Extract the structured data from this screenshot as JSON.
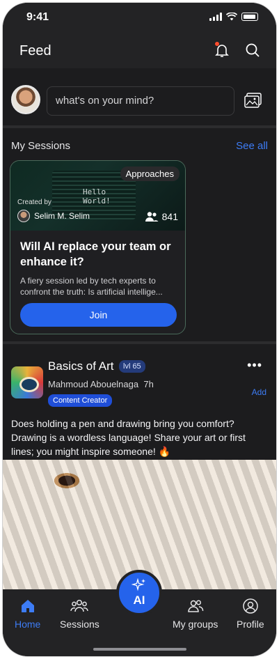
{
  "status_bar": {
    "time": "9:41"
  },
  "header": {
    "title": "Feed"
  },
  "composer": {
    "placeholder": "what's on your mind?"
  },
  "sessions": {
    "label": "My Sessions",
    "see_all": "See all",
    "card": {
      "tag": "Approaches",
      "cover_text_line1": "Hello",
      "cover_text_line2": "World!",
      "created_by_label": "Created by",
      "creator": "Selim M. Selim",
      "members": "841",
      "title": "Will AI replace your team or enhance it?",
      "description": "A fiery session led by tech experts to confront the truth: Is artificial intellige...",
      "join_label": "Join"
    }
  },
  "post": {
    "group": "Basics of Art",
    "level": "lvl 65",
    "author": "Mahmoud Abouelnaga",
    "time": "7h",
    "role": "Content Creator",
    "add_label": "Add",
    "more": "•••",
    "text": "Does holding a pen and drawing bring you comfort? Drawing is a wordless language! Share your art or first lines; you might inspire someone! 🔥"
  },
  "nav": {
    "home": "Home",
    "sessions": "Sessions",
    "ai": "AI",
    "groups": "My groups",
    "profile": "Profile"
  },
  "colors": {
    "accent": "#2563eb",
    "link": "#3d7cf5",
    "background": "#1c1c1e",
    "notification_dot": "#ff4d2e"
  },
  "icons": [
    "signal-icon",
    "wifi-icon",
    "battery-icon",
    "bell-icon",
    "search-icon",
    "image-icon",
    "users-icon",
    "home-icon",
    "sessions-icon",
    "sparkles-icon",
    "groups-icon",
    "profile-icon"
  ]
}
